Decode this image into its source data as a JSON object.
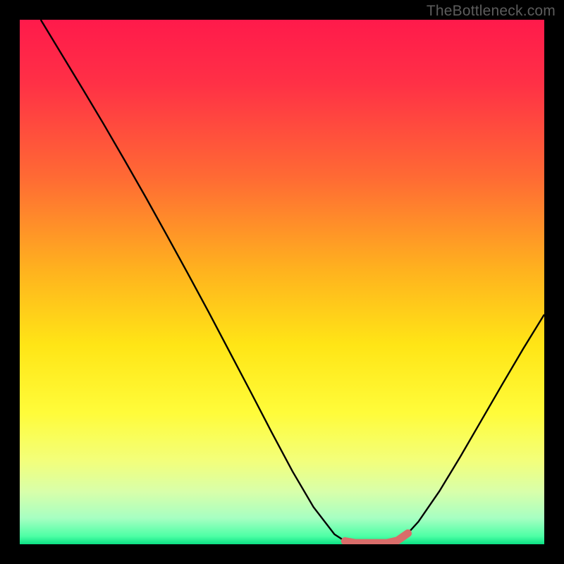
{
  "attribution": "TheBottleneck.com",
  "chart_data": {
    "type": "line",
    "title": "",
    "xlabel": "",
    "ylabel": "",
    "xlim": [
      0,
      100
    ],
    "ylim": [
      0,
      100
    ],
    "x": [
      4,
      8,
      12,
      16,
      20,
      24,
      28,
      32,
      36,
      40,
      44,
      48,
      52,
      56,
      60,
      62,
      64,
      66,
      68,
      70,
      72,
      74,
      76,
      80,
      84,
      88,
      92,
      96,
      100
    ],
    "values": [
      100.0,
      93.4,
      86.8,
      80.1,
      73.2,
      66.2,
      59.0,
      51.7,
      44.3,
      36.7,
      29.1,
      21.4,
      13.9,
      7.1,
      1.9,
      0.6,
      0.1,
      0.0,
      0.0,
      0.1,
      0.7,
      2.1,
      4.3,
      10.1,
      16.7,
      23.6,
      30.5,
      37.3,
      43.8
    ],
    "highlight_region": {
      "x_start": 60.5,
      "x_end": 74.5,
      "y": 0.25,
      "color": "#d96d6a"
    },
    "curve_color": "#000000",
    "gradient_stops": [
      {
        "offset": 0.0,
        "color": "#ff1a4b"
      },
      {
        "offset": 0.12,
        "color": "#ff3046"
      },
      {
        "offset": 0.3,
        "color": "#ff6a34"
      },
      {
        "offset": 0.48,
        "color": "#ffb31e"
      },
      {
        "offset": 0.62,
        "color": "#ffe516"
      },
      {
        "offset": 0.75,
        "color": "#fffc3a"
      },
      {
        "offset": 0.84,
        "color": "#f3ff7a"
      },
      {
        "offset": 0.9,
        "color": "#d8ffaa"
      },
      {
        "offset": 0.95,
        "color": "#a7ffc2"
      },
      {
        "offset": 0.985,
        "color": "#4cffa5"
      },
      {
        "offset": 1.0,
        "color": "#0be083"
      }
    ]
  }
}
